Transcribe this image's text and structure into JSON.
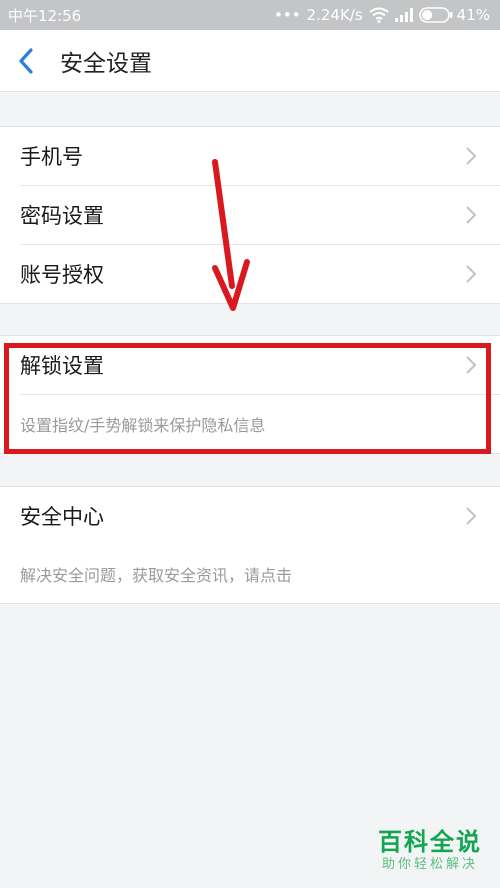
{
  "status_bar": {
    "time": "中午12:56",
    "network_speed": "2.24K/s",
    "battery_percent": "41%",
    "battery_level": 0.41
  },
  "header": {
    "title": "安全设置"
  },
  "group1": {
    "items": [
      {
        "label": "手机号"
      },
      {
        "label": "密码设置"
      },
      {
        "label": "账号授权"
      }
    ]
  },
  "group2": {
    "label": "解锁设置",
    "description": "设置指纹/手势解锁来保护隐私信息"
  },
  "group3": {
    "label": "安全中心",
    "description": "解决安全问题，获取安全资讯，请点击"
  },
  "annotation": {
    "color": "#d9191f"
  },
  "watermark": {
    "main": "百科全说",
    "sub": "助你轻松解决"
  },
  "icons": {
    "back": "back-arrow-icon",
    "chevron": "chevron-right-icon",
    "wifi": "wifi-icon",
    "signal": "signal-icon",
    "battery": "battery-icon"
  }
}
